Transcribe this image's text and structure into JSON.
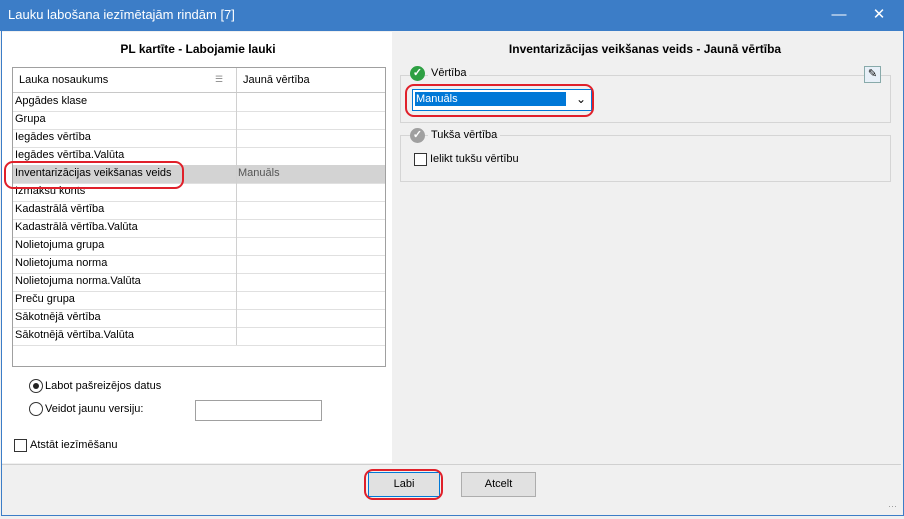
{
  "window": {
    "title": "Lauku labošana iezīmētajām rindām [7]",
    "minimize": "—",
    "close": "✕"
  },
  "left": {
    "heading": "PL kartīte - Labojamie lauki",
    "columns": {
      "name": "Lauka nosaukums",
      "value": "Jaunā vērtība"
    },
    "rows": [
      {
        "name": "Apgādes klase",
        "value": ""
      },
      {
        "name": "Grupa",
        "value": ""
      },
      {
        "name": "Iegādes vērtība",
        "value": ""
      },
      {
        "name": "Iegādes vērtība.Valūta",
        "value": ""
      },
      {
        "name": "Inventarizācijas veikšanas veids",
        "value": "Manuāls"
      },
      {
        "name": "Izmaksu konts",
        "value": ""
      },
      {
        "name": "Kadastrālā vērtība",
        "value": ""
      },
      {
        "name": "Kadastrālā vērtība.Valūta",
        "value": ""
      },
      {
        "name": "Nolietojuma grupa",
        "value": ""
      },
      {
        "name": "Nolietojuma norma",
        "value": ""
      },
      {
        "name": "Nolietojuma norma.Valūta",
        "value": ""
      },
      {
        "name": "Preču grupa",
        "value": ""
      },
      {
        "name": "Sākotnējā vērtība",
        "value": ""
      },
      {
        "name": "Sākotnējā vērtība.Valūta",
        "value": ""
      }
    ],
    "options": {
      "edit_current": "Labot pašreizējos datus",
      "new_version": "Veidot jaunu versiju:",
      "new_version_value": "",
      "keep_marks": "Atstāt iezīmēšanu"
    }
  },
  "right": {
    "heading": "Inventarizācijas veikšanas veids - Jaunā vērtība",
    "value_group": "Vērtība",
    "selected_value": "Manuāls",
    "empty_group": "Tukša vērtība",
    "empty_checkbox": "Ielikt tukšu vērtību"
  },
  "footer": {
    "ok": "Labi",
    "cancel": "Atcelt"
  },
  "colors": {
    "titlebar": "#3c7dc7",
    "accent": "#0078d7",
    "highlight_ring": "#e0202a",
    "ok_green": "#2ea043"
  }
}
